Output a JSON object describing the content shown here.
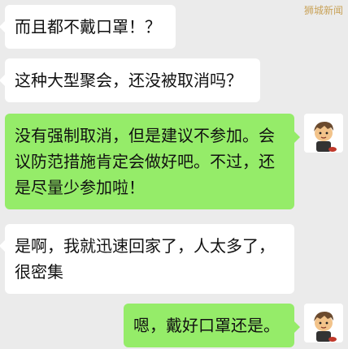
{
  "watermark": "狮城新闻",
  "messages": [
    {
      "side": "in",
      "text": "而且都不戴口罩！？"
    },
    {
      "side": "in",
      "text": "这种大型聚会，还没被取消吗？"
    },
    {
      "side": "out",
      "text": "没有强制取消，但是建议不参加。会议防范措施肯定会做好吧。不过，还是尽量少参加啦！"
    },
    {
      "side": "in",
      "text": "是啊，我就迅速回家了，人太多了，很密集"
    },
    {
      "side": "out",
      "text": "嗯，戴好口罩还是。"
    }
  ],
  "avatar_icon": "cartoon-boy-avatar",
  "colors": {
    "background": "#ebebeb",
    "incoming_bubble": "#ffffff",
    "outgoing_bubble": "#95ec69"
  }
}
